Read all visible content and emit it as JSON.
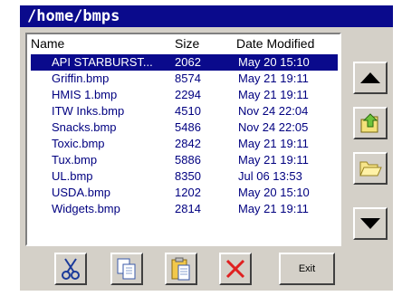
{
  "window": {
    "title": "/home/bmps"
  },
  "columns": {
    "name": "Name",
    "size": "Size",
    "date": "Date Modified"
  },
  "files": [
    {
      "name": "API STARBURST...",
      "size": "2062",
      "date": "May 20 15:10",
      "selected": true
    },
    {
      "name": "Griffin.bmp",
      "size": "8574",
      "date": "May 21 19:11"
    },
    {
      "name": "HMIS 1.bmp",
      "size": "2294",
      "date": "May 21 19:11"
    },
    {
      "name": "ITW Inks.bmp",
      "size": "4510",
      "date": "Nov 24 22:04"
    },
    {
      "name": "Snacks.bmp",
      "size": "5486",
      "date": "Nov 24 22:05"
    },
    {
      "name": "Toxic.bmp",
      "size": "2842",
      "date": "May 21 19:11"
    },
    {
      "name": "Tux.bmp",
      "size": "5886",
      "date": "May 21 19:11"
    },
    {
      "name": "UL.bmp",
      "size": "8350",
      "date": "Jul 06 13:53"
    },
    {
      "name": "USDA.bmp",
      "size": "1202",
      "date": "May 20 15:10"
    },
    {
      "name": "Widgets.bmp",
      "size": "2814",
      "date": "May 21 19:11"
    }
  ],
  "buttons": {
    "exit_label": "Exit",
    "icons": [
      "scroll-up-icon",
      "parent-folder-icon",
      "open-folder-icon",
      "scroll-down-icon",
      "cut-icon",
      "copy-icon",
      "paste-icon",
      "delete-icon"
    ]
  },
  "colors": {
    "title_bg": "#0a0a8c",
    "selection": "#0a0a8c",
    "list_text": "#000080",
    "delete": "#e02020"
  }
}
